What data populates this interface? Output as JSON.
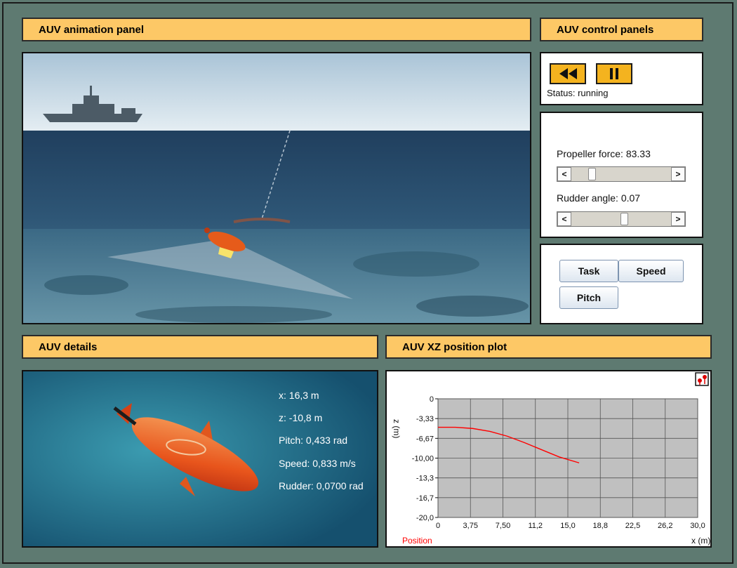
{
  "panels": {
    "animation_title": "AUV animation panel",
    "control_title": "AUV control panels",
    "details_title": "AUV details",
    "plot_title": "AUV XZ position plot"
  },
  "control": {
    "rewind_icon": "rewind-icon",
    "pause_icon": "pause-icon",
    "status": "Status: running",
    "propeller_label": "Propeller force: 83.33",
    "propeller_value": 83.33,
    "propeller_position": 0.18,
    "rudder_label": "Rudder angle: 0.07",
    "rudder_value": 0.07,
    "rudder_position": 0.53,
    "buttons": {
      "task": "Task",
      "speed": "Speed",
      "pitch": "Pitch"
    }
  },
  "details": {
    "x": "x: 16,3 m",
    "z": "z: -10,8 m",
    "pitch": "Pitch: 0,433 rad",
    "speed": "Speed: 0,833 m/s",
    "rudder": "Rudder: 0,0700 rad"
  },
  "chart_data": {
    "type": "line",
    "title": "",
    "xlabel": "x (m)",
    "ylabel": "z (m)",
    "xlim": [
      0,
      30
    ],
    "ylim": [
      -20,
      0
    ],
    "x_ticks": [
      "0",
      "3,75",
      "7,50",
      "11,2",
      "15,0",
      "18,8",
      "22,5",
      "26,2",
      "30,0"
    ],
    "y_ticks": [
      "0",
      "-3,33",
      "-6,67",
      "-10,00",
      "-13,3",
      "-16,7",
      "-20,0"
    ],
    "grid": true,
    "legend": "bottom-left",
    "series": [
      {
        "name": "Position",
        "color": "#ff0000",
        "x": [
          0,
          2,
          4,
          6,
          8,
          10,
          12,
          14,
          16.3
        ],
        "y": [
          -4.8,
          -4.8,
          -5.0,
          -5.5,
          -6.3,
          -7.4,
          -8.6,
          -9.8,
          -10.8
        ]
      }
    ],
    "plot_background": "#c0c0c0"
  },
  "colors": {
    "header_bg": "#fdc866",
    "app_bg": "#5e7a71",
    "control_button": "#f4b31f"
  }
}
